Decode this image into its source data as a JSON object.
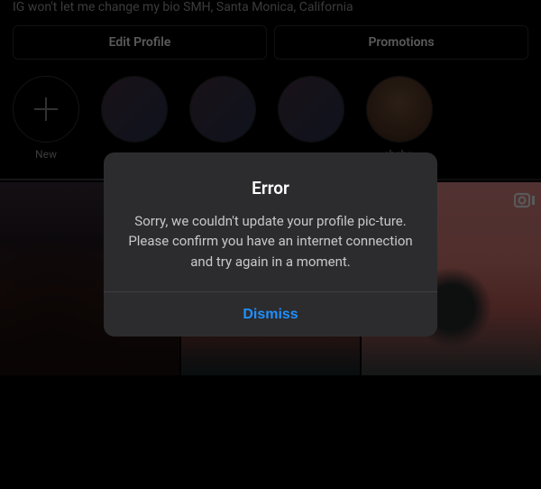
{
  "profile": {
    "bio": "IG won't let me change my bio SMH, Santa Monica, California",
    "edit_label": "Edit Profile",
    "promo_label": "Promotions"
  },
  "stories": {
    "new_label": "New",
    "items": [
      {
        "label": ""
      },
      {
        "label": ""
      },
      {
        "label": ""
      },
      {
        "label": "ehehe."
      }
    ]
  },
  "dialog": {
    "title": "Error",
    "message": "Sorry, we couldn't update your profile pic-ture. Please confirm you have an internet connection and try again in a moment.",
    "dismiss_label": "Dismiss"
  }
}
